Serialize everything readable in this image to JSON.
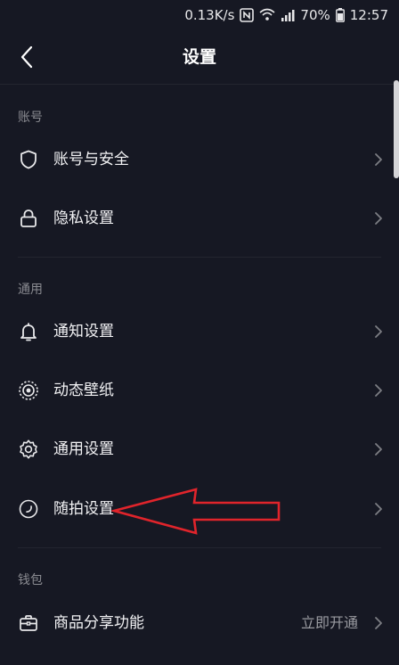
{
  "status_bar": {
    "speed": "0.13K/s",
    "battery": "70%",
    "time": "12:57"
  },
  "header": {
    "title": "设置"
  },
  "sections": {
    "account": {
      "title": "账号",
      "items": [
        {
          "label": "账号与安全",
          "icon": "shield-icon"
        },
        {
          "label": "隐私设置",
          "icon": "lock-icon"
        }
      ]
    },
    "general": {
      "title": "通用",
      "items": [
        {
          "label": "通知设置",
          "icon": "bell-icon"
        },
        {
          "label": "动态壁纸",
          "icon": "live-wallpaper-icon"
        },
        {
          "label": "通用设置",
          "icon": "gear-icon"
        },
        {
          "label": "随拍设置",
          "icon": "quick-shot-icon"
        }
      ]
    },
    "wallet": {
      "title": "钱包",
      "items": [
        {
          "label": "商品分享功能",
          "icon": "briefcase-icon",
          "action": "立即开通"
        }
      ]
    }
  },
  "colors": {
    "background": "#161823",
    "annotation_arrow": "#e0242b"
  }
}
